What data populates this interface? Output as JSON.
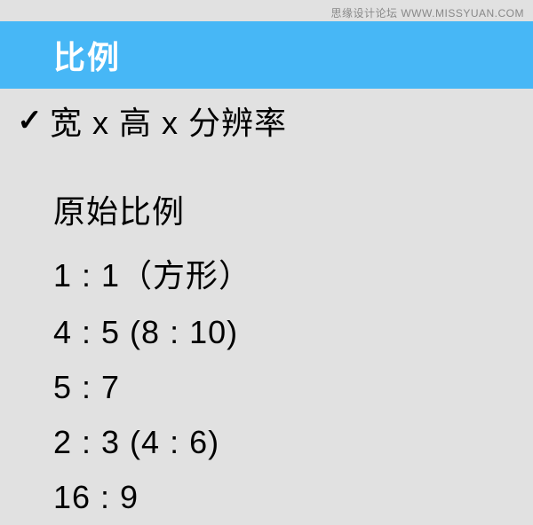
{
  "watermark": "思缘设计论坛 WWW.MISSYUAN.COM",
  "menu": {
    "header": "比例",
    "items": [
      {
        "label": "宽 x 高 x 分辨率",
        "checked": true
      },
      {
        "label": "原始比例",
        "checked": false
      },
      {
        "label": "1 : 1（方形）",
        "checked": false
      },
      {
        "label": "4 : 5 (8 : 10)",
        "checked": false
      },
      {
        "label": "5 : 7",
        "checked": false
      },
      {
        "label": "2 : 3 (4 : 6)",
        "checked": false
      },
      {
        "label": "16 : 9",
        "checked": false
      }
    ]
  }
}
